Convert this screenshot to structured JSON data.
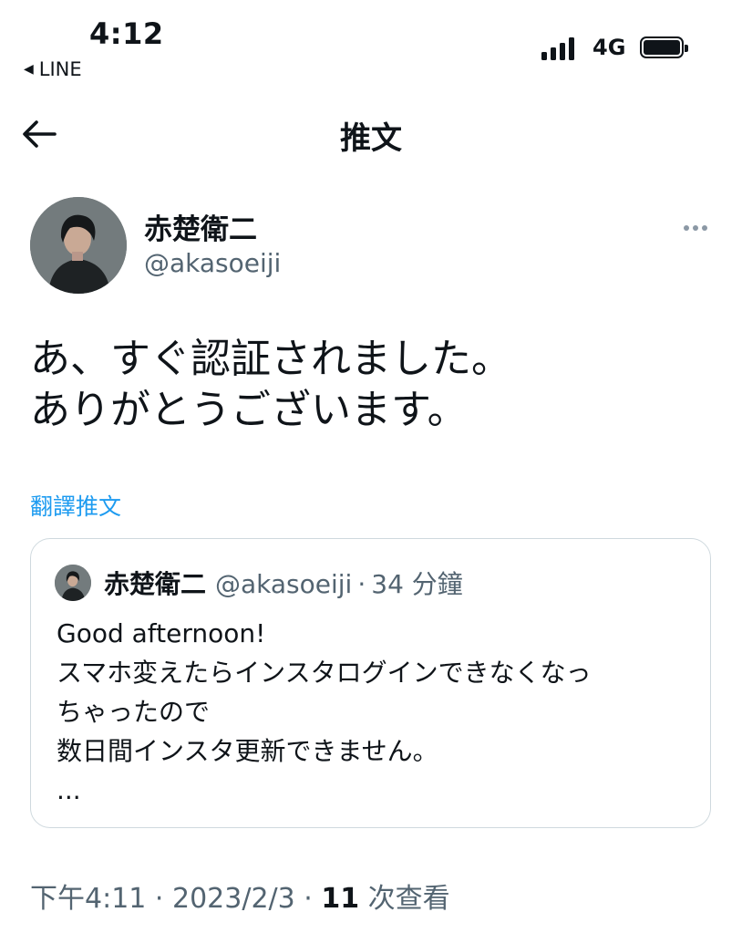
{
  "status_bar": {
    "time": "4:12",
    "back_app": "LINE",
    "network": "4G"
  },
  "header": {
    "title": "推文"
  },
  "tweet": {
    "author_name": "赤楚衛二",
    "author_handle": "@akasoeiji",
    "text_lines": [
      "あ、すぐ認証されました。",
      "ありがとうございます。"
    ],
    "translate_label": "翻譯推文",
    "time": "下午4:11",
    "date": "2023/2/3",
    "views_count": "11",
    "views_label": "次查看"
  },
  "quote": {
    "author_name": "赤楚衛二",
    "author_handle": "@akasoeiji",
    "meta_sep": "·",
    "age": "34 分鐘",
    "text_lines": [
      "Good afternoon!",
      "スマホ変えたらインスタログインできなくなっ",
      "ちゃったので",
      "数日間インスタ更新できません。",
      "..."
    ]
  },
  "colors": {
    "text": "#0f1419",
    "secondary": "#536471",
    "link": "#1d9bf0",
    "border": "#cfd9de"
  }
}
